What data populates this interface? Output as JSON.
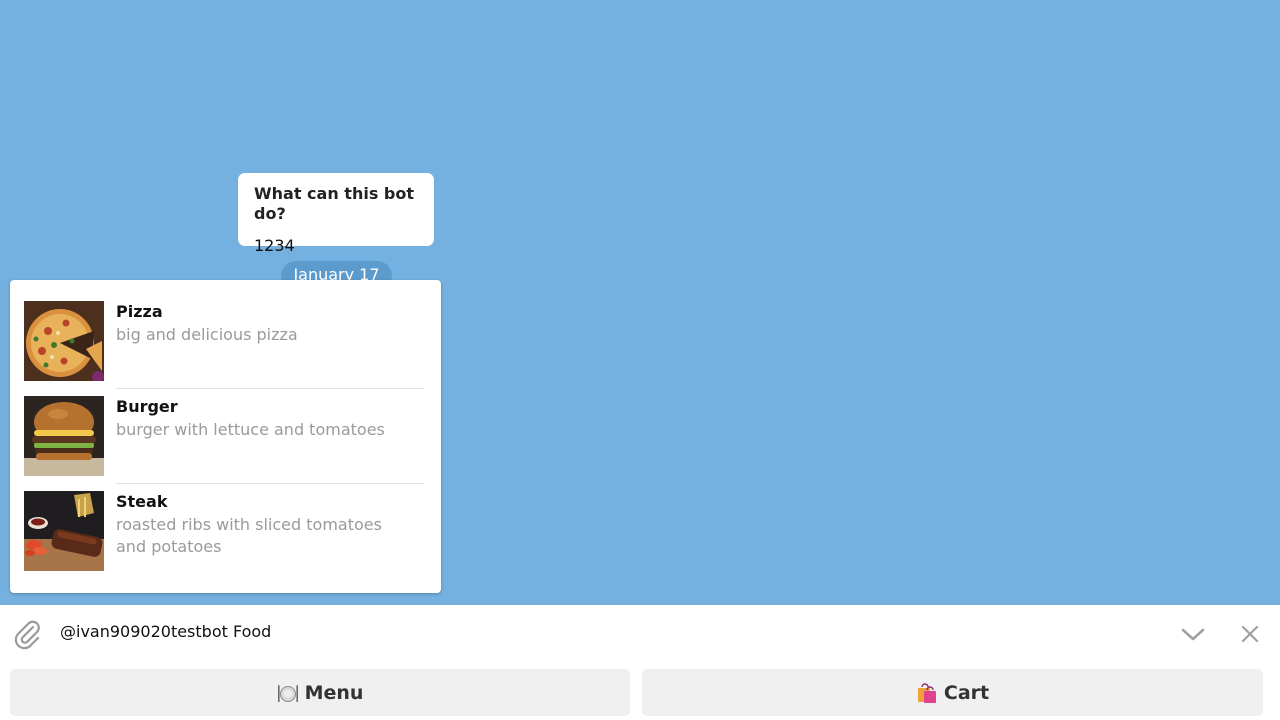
{
  "bot_info": {
    "title": "What can this bot do?",
    "text": "1234"
  },
  "date_separator": "January 17",
  "inline_results": [
    {
      "title": "Pizza",
      "description": "big and delicious pizza",
      "thumbnail": "pizza-photo"
    },
    {
      "title": "Burger",
      "description": "burger with lettuce and tomatoes",
      "thumbnail": "burger-photo"
    },
    {
      "title": "Steak",
      "description": "roasted ribs with sliced tomatoes and potatoes",
      "thumbnail": "steak-photo"
    }
  ],
  "input": {
    "value": "@ivan909020testbot Food",
    "attach_icon": "paperclip-icon",
    "collapse_icon": "chevron-down-icon",
    "close_icon": "close-icon"
  },
  "keyboard": {
    "buttons": [
      {
        "label": "Menu",
        "icon": "plate-cutlery-emoji"
      },
      {
        "label": "Cart",
        "icon": "shopping-bags-emoji"
      }
    ]
  },
  "colors": {
    "chat_background": "#74b1e0",
    "date_pill": "#5c9bcd",
    "keyboard_button": "#f0f0f0"
  }
}
